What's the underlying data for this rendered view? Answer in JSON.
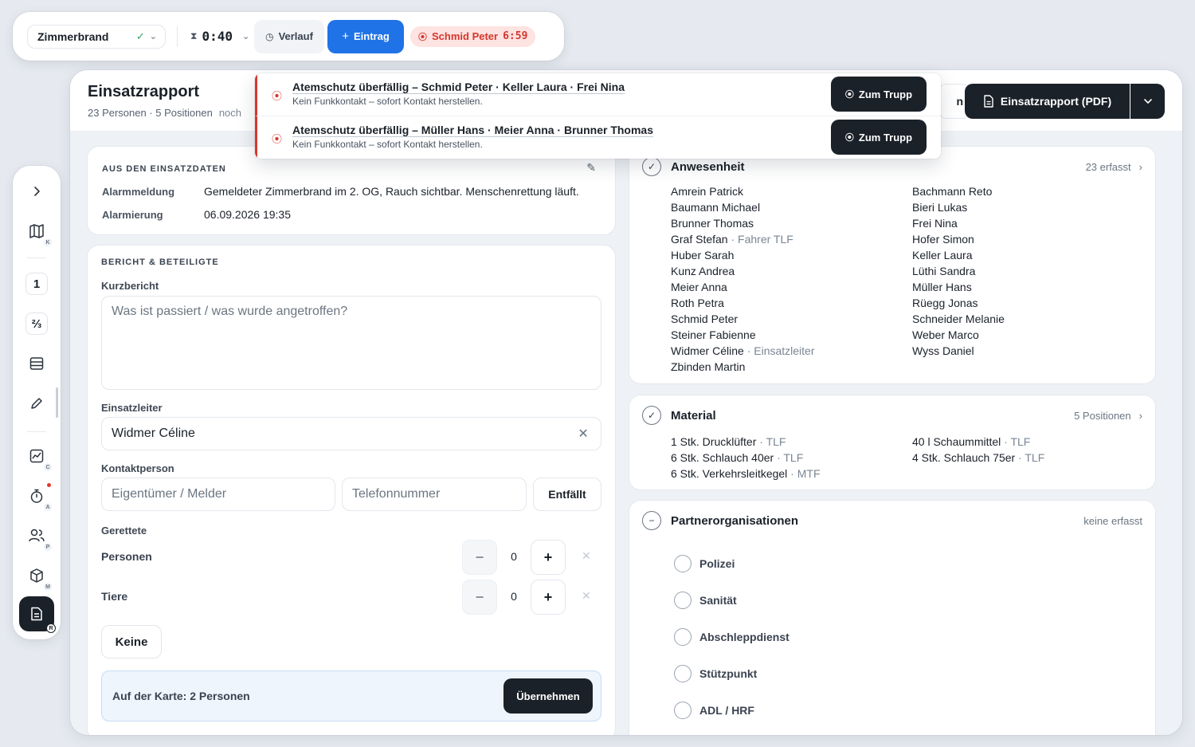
{
  "toolbar": {
    "incident": "Zimmerbrand",
    "timer": "0:40",
    "history_label": "Verlauf",
    "entry_label": "Eintrag",
    "alert_name": "Schmid Peter",
    "alert_time": "6:59",
    "colors": {
      "primary": "#1f73e6",
      "alert_bg": "#fde3e1",
      "alert_fg": "#d6372e"
    }
  },
  "rail": {
    "expand_icon": "chevron-right-icon",
    "items": [
      {
        "icon": "map-icon",
        "badge": "K"
      },
      {
        "icon": "number-one",
        "label": "1"
      },
      {
        "icon": "fraction-icon",
        "label": "⅔"
      },
      {
        "icon": "list-icon"
      },
      {
        "icon": "pencil-icon"
      },
      {
        "icon": "chart-icon",
        "badge": "C"
      },
      {
        "icon": "stopwatch-icon",
        "badge": "A"
      },
      {
        "icon": "users-icon",
        "badge": "P"
      },
      {
        "icon": "box-icon",
        "badge": "M"
      },
      {
        "icon": "report-icon",
        "badge": "R"
      }
    ]
  },
  "header": {
    "title": "Einsatzrapport",
    "subtitle": "23 Personen · 5 Positionen",
    "noch": "noch",
    "hidden_btn": "n",
    "pdf_label": "Einsatzrapport (PDF)"
  },
  "toasts": [
    {
      "title": "Atemschutz überfällig – Schmid Peter · Keller Laura · Frei Nina",
      "sub": "Kein Funkkontakt – sofort Kontakt herstellen.",
      "action": "Zum Trupp"
    },
    {
      "title": "Atemschutz überfällig – Müller Hans · Meier Anna · Brunner Thomas",
      "sub": "Kein Funkkontakt – sofort Kontakt herstellen.",
      "action": "Zum Trupp"
    }
  ],
  "source": {
    "title": "AUS DEN EINSATZDATEN",
    "rows": [
      {
        "k": "Alarmmeldung",
        "v": "Gemeldeter Zimmerbrand im 2. OG, Rauch sichtbar. Menschenrettung läuft."
      },
      {
        "k": "Alarmierung",
        "v": "06.09.2026 19:35"
      }
    ]
  },
  "report": {
    "title": "BERICHT & BETEILIGTE",
    "short_label": "Kurzbericht",
    "short_placeholder": "Was ist passiert / was wurde angetroffen?",
    "leader_label": "Einsatzleiter",
    "leader_value": "Widmer Céline",
    "contact_label": "Kontaktperson",
    "contact_placeholder": "Eigentümer / Melder",
    "phone_placeholder": "Telefonnummer",
    "contact_none": "Entfällt",
    "rescued_label": "Gerettete",
    "rescued": [
      {
        "label": "Personen",
        "value": "0"
      },
      {
        "label": "Tiere",
        "value": "0"
      }
    ],
    "none_label": "Keine",
    "map_text": "Auf der Karte: 2 Personen",
    "map_action": "Übernehmen"
  },
  "attendance": {
    "title": "Anwesenheit",
    "meta": "23 erfasst",
    "left": [
      {
        "n": "Amrein Patrick",
        "r": ""
      },
      {
        "n": "Baumann Michael",
        "r": ""
      },
      {
        "n": "Brunner Thomas",
        "r": ""
      },
      {
        "n": "Graf Stefan",
        "r": " · Fahrer TLF"
      },
      {
        "n": "Huber Sarah",
        "r": ""
      },
      {
        "n": "Kunz Andrea",
        "r": ""
      },
      {
        "n": "Meier Anna",
        "r": ""
      },
      {
        "n": "Roth Petra",
        "r": ""
      },
      {
        "n": "Schmid Peter",
        "r": ""
      },
      {
        "n": "Steiner Fabienne",
        "r": ""
      },
      {
        "n": "Widmer Céline",
        "r": " · Einsatzleiter"
      },
      {
        "n": "Zbinden Martin",
        "r": ""
      }
    ],
    "right": [
      {
        "n": "Bachmann Reto",
        "r": ""
      },
      {
        "n": "Bieri Lukas",
        "r": ""
      },
      {
        "n": "Frei Nina",
        "r": ""
      },
      {
        "n": "Hofer Simon",
        "r": ""
      },
      {
        "n": "Keller Laura",
        "r": ""
      },
      {
        "n": "Lüthi Sandra",
        "r": ""
      },
      {
        "n": "Müller Hans",
        "r": ""
      },
      {
        "n": "Rüegg Jonas",
        "r": ""
      },
      {
        "n": "Schneider Melanie",
        "r": ""
      },
      {
        "n": "Weber Marco",
        "r": ""
      },
      {
        "n": "Wyss Daniel",
        "r": ""
      }
    ]
  },
  "material": {
    "title": "Material",
    "meta": "5 Positionen",
    "items": [
      {
        "q": "1 Stk. Drucklüfter",
        "r": " · TLF"
      },
      {
        "q": "40 l Schaummittel",
        "r": " · TLF"
      },
      {
        "q": "6 Stk. Schlauch 40er",
        "r": " · TLF"
      },
      {
        "q": "4 Stk. Schlauch 75er",
        "r": " · TLF"
      },
      {
        "q": "6 Stk. Verkehrsleitkegel",
        "r": " · MTF"
      }
    ]
  },
  "partners": {
    "title": "Partnerorganisationen",
    "meta": "keine erfasst",
    "items": [
      "Polizei",
      "Sanität",
      "Abschleppdienst",
      "Stützpunkt",
      "ADL / HRF"
    ]
  }
}
